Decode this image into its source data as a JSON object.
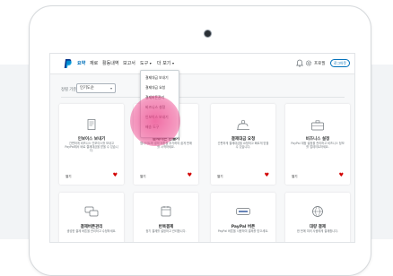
{
  "nav": {
    "items": [
      "요약",
      "재로",
      "활동내역",
      "보고서",
      "도구"
    ],
    "more_label": "더 보기",
    "user_label": "프로필",
    "logout_label": "로그아웃"
  },
  "filter": {
    "label": "정렬 기준",
    "selected": "인기도순"
  },
  "dropdown": {
    "items": [
      "결제대금 보내기",
      "결제대금 요청",
      "결제버튼관리",
      "비즈니스 설정",
      "인보이스 보내기",
      "배송 도구"
    ]
  },
  "cards_row1": [
    {
      "title": "인보이스 보내기",
      "desc": "간편하게 비즈니스 인보이스를 보내고 PayPal에서 바로 결제대금을 받을 수 있습니다.",
      "more": "열기"
    },
    {
      "title": "결제버튼 만들기",
      "desc": "웹사이트에 결제 버튼을 추가하여 쉽게 판매를 시작하세요.",
      "more": "열기"
    },
    {
      "title": "결제대금 요청",
      "desc": "간편하게 결제대금을 요청하고 빠르게 받을 수 있습니다.",
      "more": "열기"
    },
    {
      "title": "비즈니스 설정",
      "desc": "PayPal 계정 설정을 관리하고 비즈니스 정보를 업데이트하세요.",
      "more": "열기"
    }
  ],
  "cards_row2": [
    {
      "title": "결제버튼관리",
      "desc": "생성한 결제 버튼을 관리하고 수정하세요."
    },
    {
      "title": "반복결제",
      "desc": "정기 결제를 설정하고 관리합니다."
    },
    {
      "title": "PayPal 버튼",
      "desc": "PayPal 버튼을 사용하여 결제를 받으세요."
    },
    {
      "title": "대량 결제",
      "desc": "한 번에 여러 사람에게 결제합니다."
    }
  ],
  "colors": {
    "accent": "#0070ba",
    "heart": "#d20000",
    "highlight": "#ec468c"
  },
  "icons": [
    "paypal-logo-icon",
    "bell-icon",
    "gear-icon",
    "invoice-icon",
    "button-icon",
    "request-icon",
    "briefcase-icon",
    "chat-icon",
    "calendar-icon",
    "paypal-button-icon",
    "globe-icon"
  ]
}
